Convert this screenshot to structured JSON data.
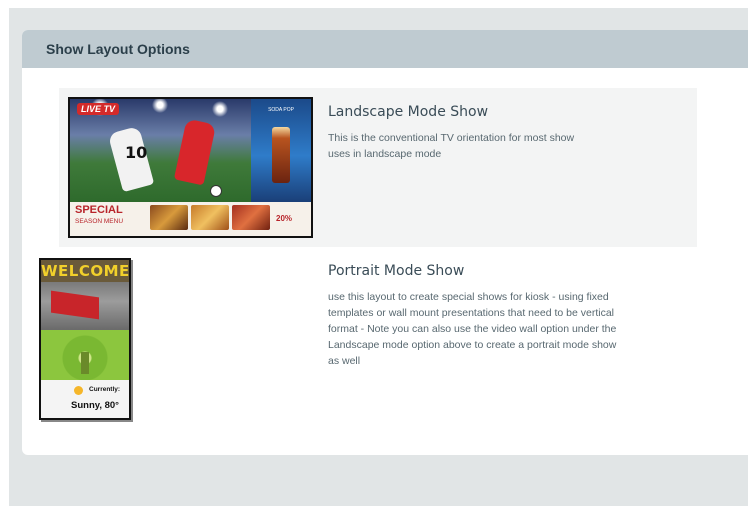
{
  "panel": {
    "title": "Show Layout Options"
  },
  "options": [
    {
      "title": "Landscape Mode Show",
      "description": "This is the conventional TV orientation for most show uses in landscape mode",
      "thumbnail": {
        "badge": "LIVE TV",
        "player_number": "10",
        "drink_label": "SODA POP",
        "special": "SPECIAL",
        "season": "SEASON MENU",
        "discount": "20%"
      }
    },
    {
      "title": "Portrait Mode Show",
      "description": "use this layout to create special shows for kiosk - using fixed templates or wall mount presentations that need to be vertical format - Note you can also use the video wall option under the Landscape mode option above to create a portrait mode show as well",
      "thumbnail": {
        "welcome": "WELCOME",
        "currently": "Currently:",
        "weather": "Sunny, 80°"
      }
    }
  ]
}
